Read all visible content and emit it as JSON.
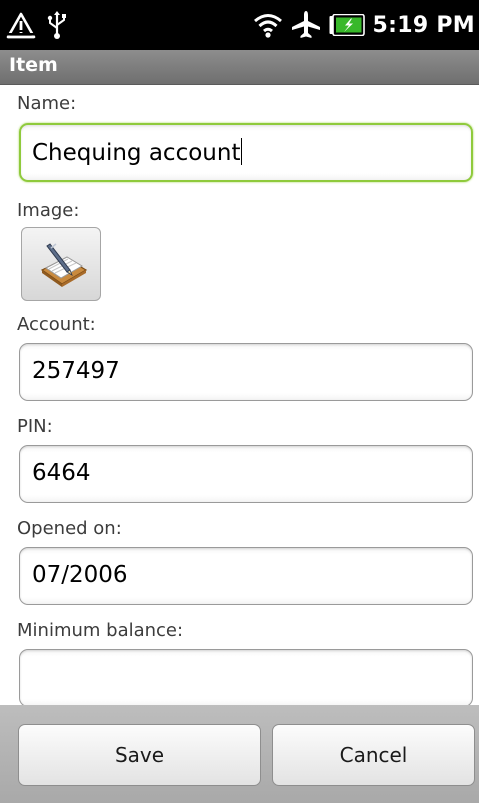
{
  "status_bar": {
    "time": "5:19 PM",
    "icons": [
      "warning-icon",
      "usb-icon",
      "wifi-icon",
      "airplane-icon",
      "battery-charging-icon"
    ],
    "battery_color": "#38b82a"
  },
  "title_bar": {
    "title": "Item"
  },
  "form": {
    "name_label": "Name:",
    "name_value": "Chequing account",
    "image_label": "Image:",
    "image_icon": "cheque-book-icon",
    "account_label": "Account:",
    "account_value": "257497",
    "pin_label": "PIN:",
    "pin_value": "6464",
    "opened_label": "Opened on:",
    "opened_value": "07/2006",
    "min_balance_label": "Minimum balance:",
    "min_balance_value": ""
  },
  "actions": {
    "save_label": "Save",
    "cancel_label": "Cancel"
  },
  "colors": {
    "focus_border": "#8fca3c",
    "title_bar": "#7e7e7e"
  }
}
